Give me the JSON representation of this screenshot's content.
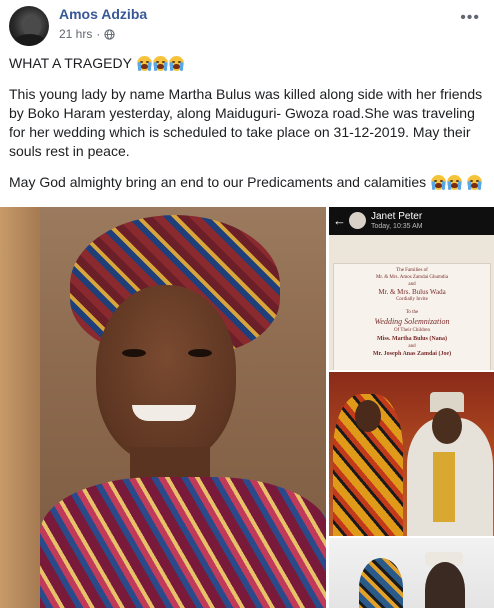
{
  "post": {
    "author": "Amos Adziba",
    "time": "21 hrs",
    "separator": "·",
    "more": "•••",
    "paragraphs": [
      "WHAT A TRAGEDY",
      "This young lady by name Martha Bulus was killed along side with her friends by Boko Haram yesterday, along Maiduguri- Gwoza road.She was traveling for her wedding which is scheduled to take place on 31-12-2019. May their souls rest in peace.",
      "May God almighty bring an end to our Predicaments and calamities"
    ],
    "emojis": {
      "p0": [
        "crying-face",
        "crying-face",
        "crying-face"
      ],
      "p2": [
        "crying-face",
        "crying-face",
        "crying-face"
      ]
    }
  },
  "screenshot": {
    "back": "←",
    "contact": "Janet Peter",
    "timestamp": "Today, 10:35 AM",
    "card_lines": [
      "The Families of",
      "Mr. & Mrs. Amos Zamdai Ghumdia",
      "and",
      "Mr. & Mrs. Bulus Wada",
      "Cordially Invite",
      "To the",
      "Wedding Solemnization",
      "Of Their Children",
      "Miss. Martha Bulus (Nana)",
      "and",
      "Mr. Joseph Anas Zamdai (Joe)"
    ]
  },
  "colors": {
    "name": "#385898",
    "meta": "#616770",
    "text": "#1c1e21"
  }
}
